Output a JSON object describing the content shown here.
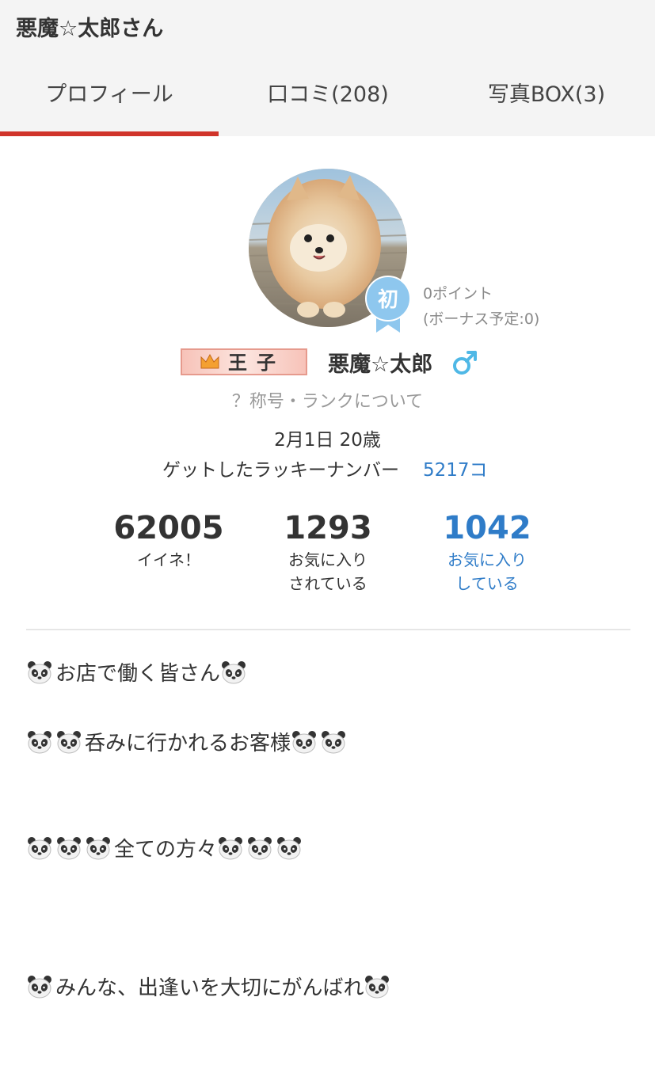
{
  "header": {
    "title": "悪魔☆太郎さん",
    "tabs": [
      {
        "label": "プロフィール",
        "active": true
      },
      {
        "label": "口コミ(208)",
        "active": false
      },
      {
        "label": "写真BOX(3)",
        "active": false
      }
    ],
    "active_color": "#d0342a"
  },
  "profile": {
    "avatar_icon": "pomeranian-photo",
    "badge_text": "初",
    "points": "0ポイント",
    "bonus": "(ボーナス予定:0)",
    "title_badge": "王子",
    "name": "悪魔☆太郎",
    "gender_icon": "male-icon",
    "rank_link": "？称号・ランクについて",
    "birthday": "2月1日 20歳",
    "lucky_label": "ゲットしたラッキーナンバー",
    "lucky_value": "5217コ"
  },
  "stats": [
    {
      "value": "62005",
      "label1": "イイネ！",
      "label2": ""
    },
    {
      "value": "1293",
      "label1": "お気に入り",
      "label2": "されている"
    },
    {
      "value": "1042",
      "label1": "お気に入り",
      "label2": "している"
    }
  ],
  "bio": {
    "lines": [
      "お店で働く皆さん",
      "呑みに行かれるお客様",
      "全ての方々",
      "みんな、出逢いを大切にがんばれ"
    ],
    "emoji_icon": "panda-icon"
  },
  "colors": {
    "link": "#2f7cc8",
    "accent": "#d0342a",
    "badge_blue": "#8ec7ee"
  }
}
